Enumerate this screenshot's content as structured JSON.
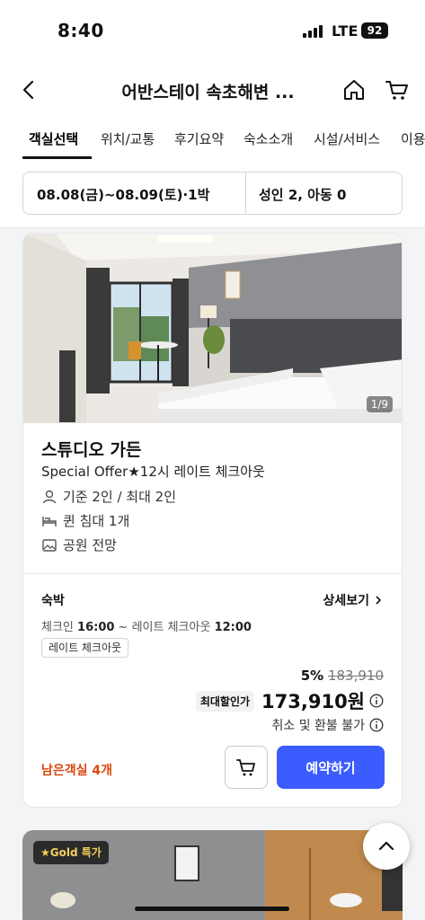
{
  "status": {
    "time": "8:40",
    "network": "LTE",
    "battery": "92"
  },
  "header": {
    "title": "어반스테이 속초해변 ..."
  },
  "tabs": [
    "객실선택",
    "위치/교통",
    "후기요약",
    "숙소소개",
    "시설/서비스",
    "이용"
  ],
  "filter": {
    "dates": "08.08(금)~08.09(토)·1박",
    "guests": "성인 2, 아동 0"
  },
  "room": {
    "image_counter": "1/9",
    "name": "스튜디오 가든",
    "offer": "Special Offer★12시 레이트 체크아웃",
    "features": {
      "capacity": "기준 2인 / 최대 2인",
      "bed": "퀸 침대 1개",
      "view": "공원 전망"
    },
    "stay_type": "숙박",
    "detail_link": "상세보기",
    "checkin_label": "체크인",
    "checkin_time": "16:00",
    "checkout_sep": " ~ 레이트 체크아웃",
    "checkout_time": "12:00",
    "badge": "레이트 체크아웃",
    "discount_pct": "5%",
    "original_price": "183,910",
    "max_discount_label": "최대할인가",
    "price": "173,910원",
    "refund": "취소 및 환불 불가",
    "remaining": "남은객실 4개",
    "reserve_button": "예약하기"
  },
  "next_card": {
    "badge": "★Gold 특가"
  },
  "colors": {
    "accent": "#3b5cff",
    "remaining": "#d9480f"
  }
}
